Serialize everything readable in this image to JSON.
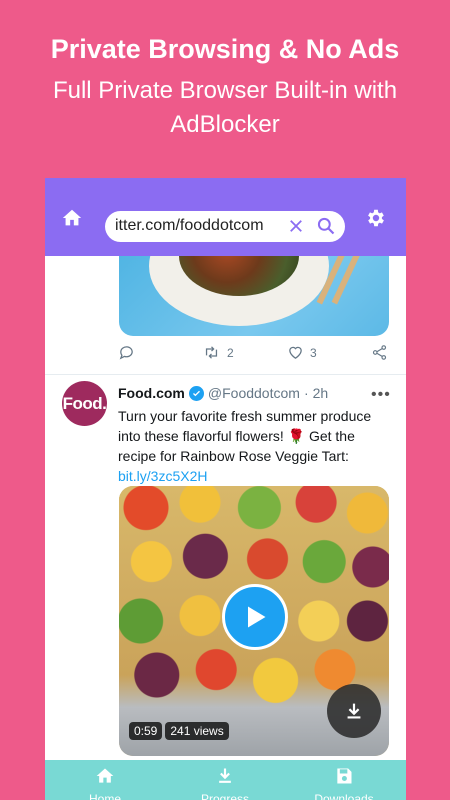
{
  "promo": {
    "title": "Private Browsing & No Ads",
    "subtitle": "Full Private Browser Built-in with AdBlocker"
  },
  "toolbar": {
    "url": "itter.com/fooddotcom",
    "home_icon": "home-icon",
    "clear_icon": "close-icon",
    "search_icon": "search-icon",
    "settings_icon": "gear-icon",
    "color": "#8b6cf2"
  },
  "prev_tweet": {
    "retweets": "2",
    "likes": "3"
  },
  "tweet": {
    "avatar_text": "Food.",
    "name": "Food.com",
    "handle": "@Fooddotcom",
    "separator": "·",
    "time": "2h",
    "text_main": "Turn your favorite fresh summer produce into these flavorful flowers! 🌹 Get the recipe for Rainbow Rose Veggie Tart: ",
    "link": "bit.ly/3zc5X2H",
    "video": {
      "duration": "0:59",
      "views": "241 views"
    }
  },
  "bottom_nav": {
    "items": [
      {
        "label": "Home",
        "icon": "home-icon"
      },
      {
        "label": "Progress",
        "icon": "download-icon"
      },
      {
        "label": "Downloads",
        "icon": "save-icon"
      }
    ],
    "color": "#79d9d4"
  },
  "colors": {
    "background": "#ee5a8a",
    "twitter_blue": "#1da1f2"
  }
}
